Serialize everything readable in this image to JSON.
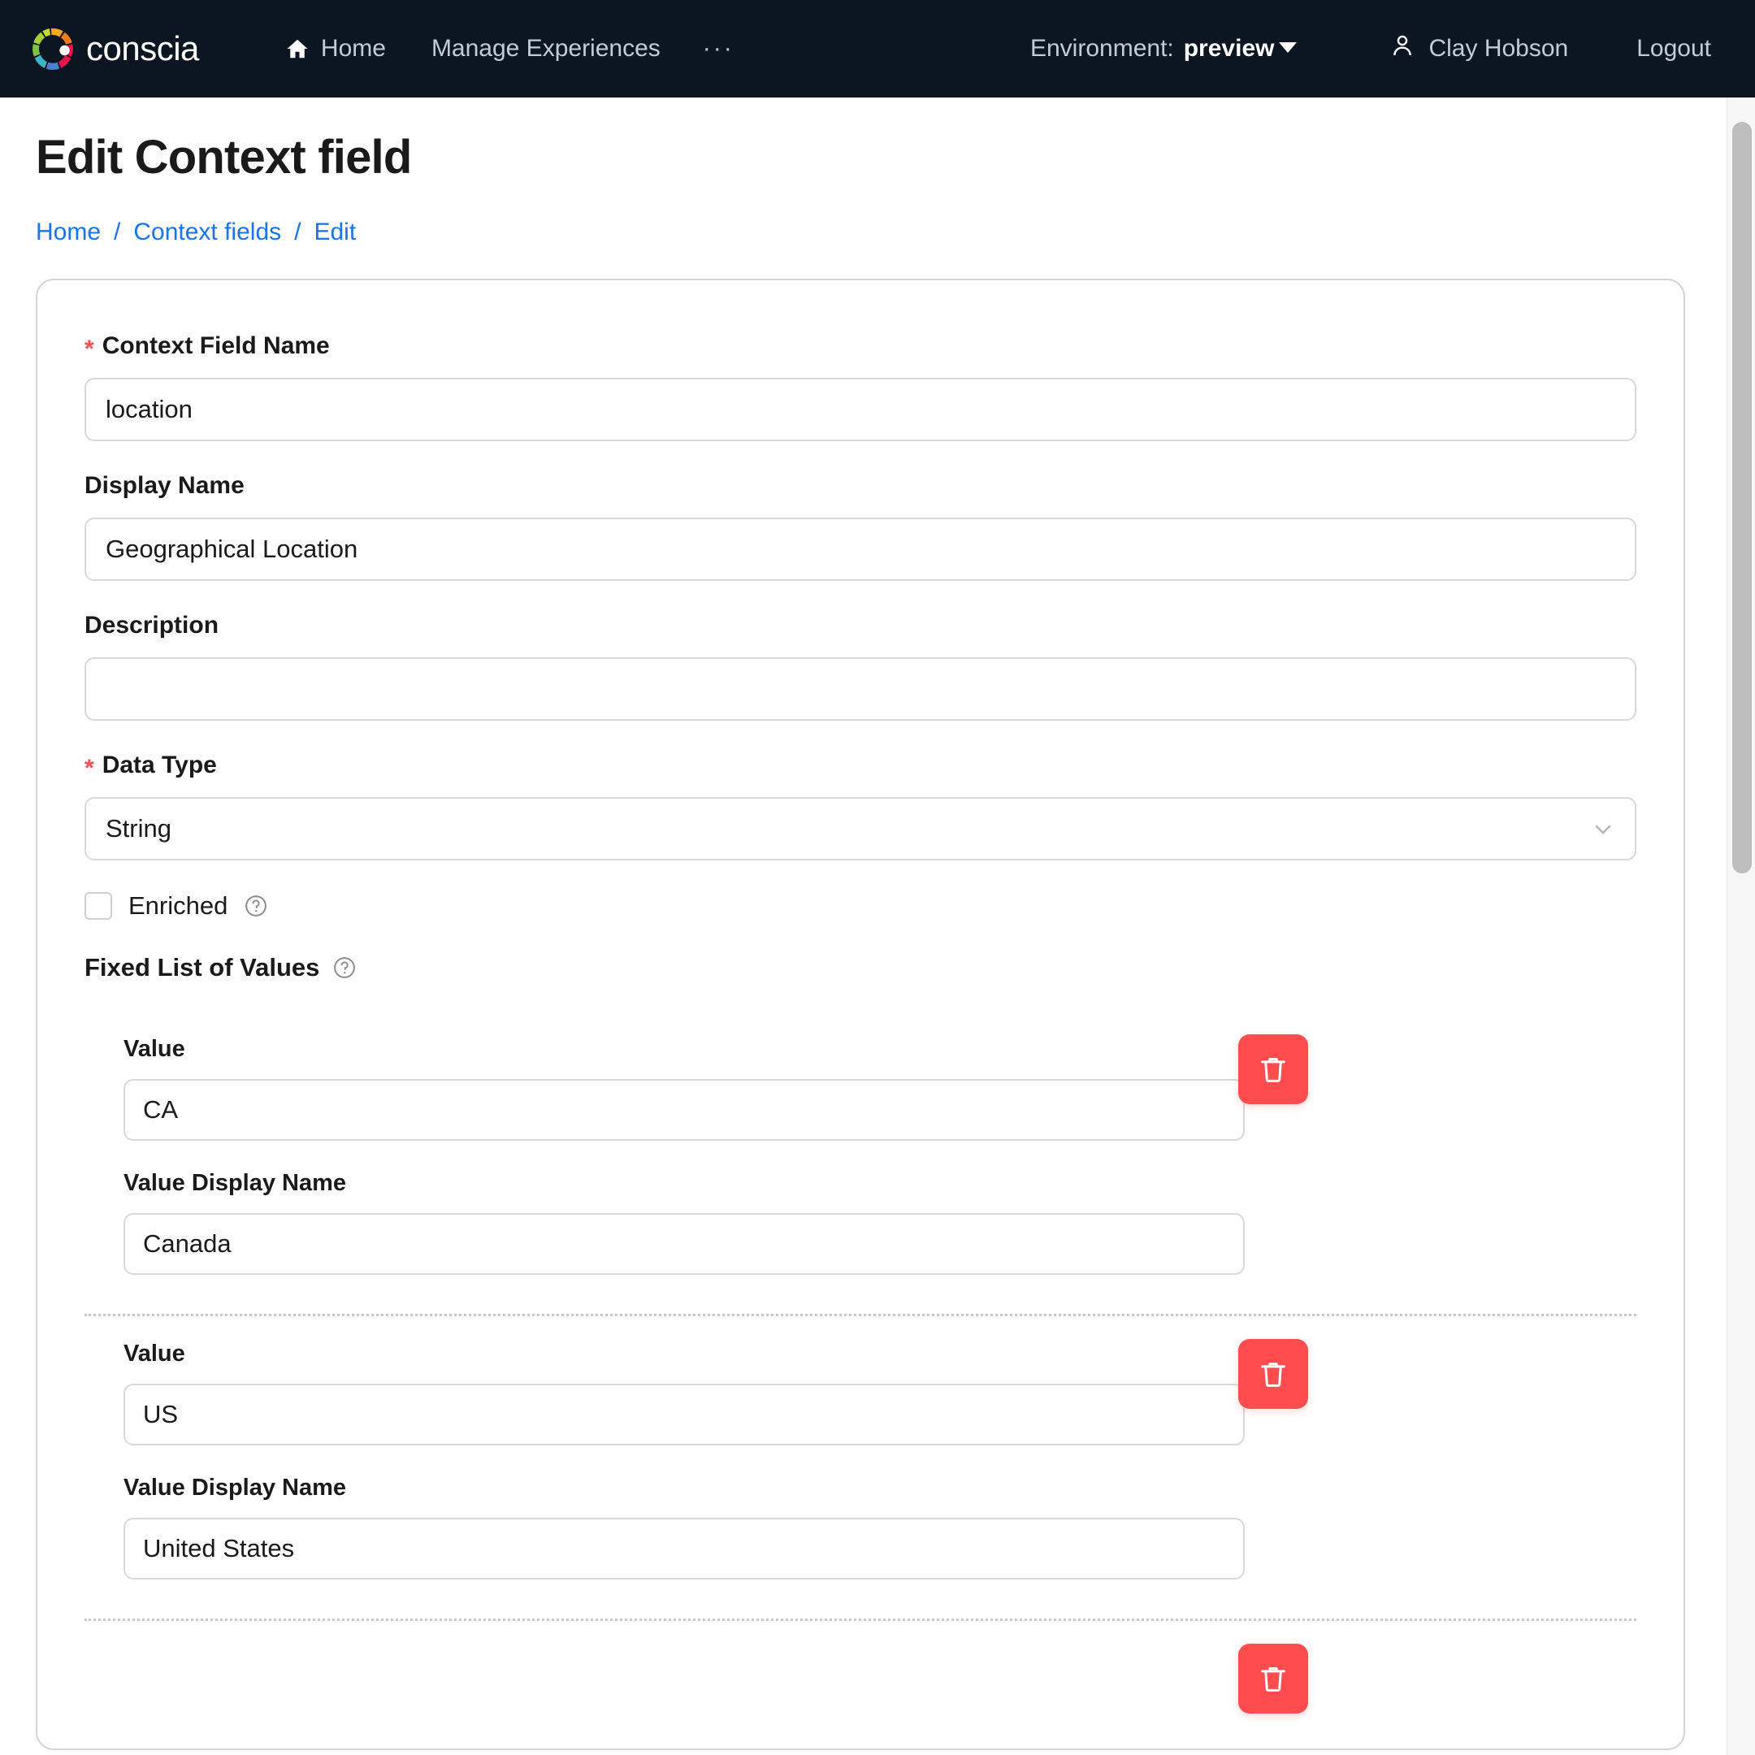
{
  "topbar": {
    "brand": {
      "name": "conscia",
      "logo_icon": "conscia-ring-logo"
    },
    "nav": [
      {
        "label": "Home",
        "icon": "home-icon"
      },
      {
        "label": "Manage Experiences",
        "icon": ""
      }
    ],
    "overflow_label": "···",
    "environment": {
      "label": "Environment:",
      "value": "preview",
      "caret_icon": "caret-down-icon"
    },
    "user": {
      "name": "Clay Hobson",
      "icon": "user-icon"
    },
    "logout_label": "Logout",
    "bg_color": "#0b1622",
    "text_color": "#c2ccd6"
  },
  "page": {
    "title": "Edit Context field",
    "breadcrumb": [
      {
        "label": "Home"
      },
      {
        "label": "Context fields"
      },
      {
        "label": "Edit"
      }
    ],
    "breadcrumb_separator": "/",
    "link_color": "#1a73e8"
  },
  "form": {
    "context_field_name": {
      "label": "Context Field Name",
      "required": true,
      "value": "location",
      "placeholder": ""
    },
    "display_name": {
      "label": "Display Name",
      "required": false,
      "value": "Geographical Location",
      "placeholder": ""
    },
    "description": {
      "label": "Description",
      "required": false,
      "value": "",
      "placeholder": ""
    },
    "data_type": {
      "label": "Data Type",
      "required": true,
      "value": "String",
      "chevron_icon": "chevron-down-icon"
    },
    "enriched": {
      "label": "Enriched",
      "checked": false,
      "help_icon": "question-circle-icon"
    },
    "fixed_list": {
      "label": "Fixed List of Values",
      "help_icon": "question-circle-icon",
      "value_label": "Value",
      "display_name_label": "Value Display Name",
      "delete_icon": "trash-icon",
      "delete_color": "#ff4d4f",
      "entries": [
        {
          "value": "CA",
          "display_name": "Canada"
        },
        {
          "value": "US",
          "display_name": "United States"
        },
        {
          "value": "",
          "display_name": ""
        }
      ]
    },
    "required_marker": "*",
    "required_color": "#ff4d4f"
  },
  "scrollbar": {
    "name": "vertical-scrollbar",
    "thumb_color": "#bdbdbd"
  }
}
